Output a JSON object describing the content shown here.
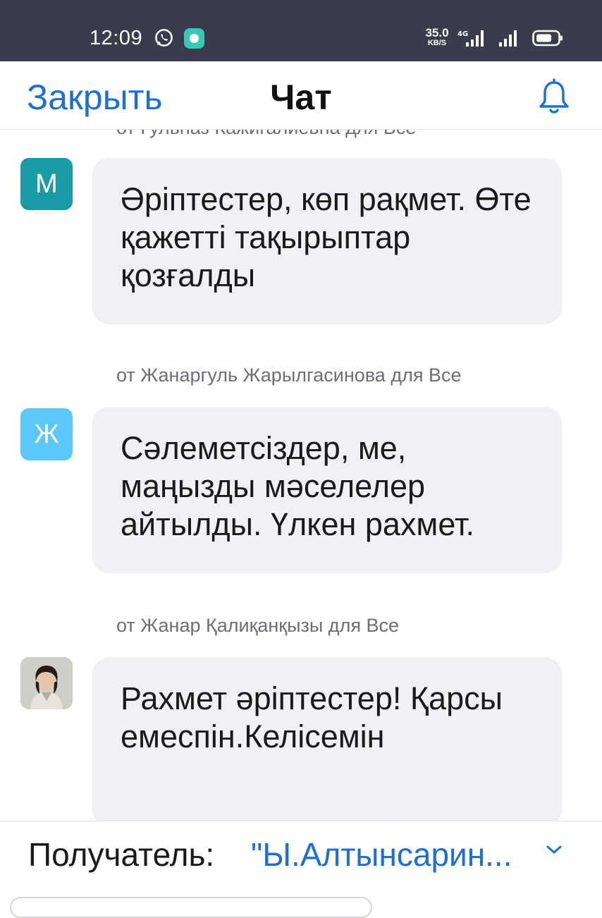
{
  "status_bar": {
    "time": "12:09",
    "net_speed_value": "35.0",
    "net_speed_unit": "KB/S",
    "network_type": "4G"
  },
  "nav": {
    "close_label": "Закрыть",
    "title": "Чат"
  },
  "messages": [
    {
      "sender": "от Гульназ Кажигалиевна для Все",
      "avatar_letter": "М",
      "avatar_color": "#1a9ba6",
      "text": "Әріптестер, көп рақмет. Өте қажетті тақырыптар қозғалды"
    },
    {
      "sender": "от Жанаргуль Жарылгасинова для Все",
      "avatar_letter": "Ж",
      "avatar_color": "#5ac8fa",
      "text": "Сәлеметсіздер, ме, маңызды мәселелер айтылды. Үлкен рахмет."
    },
    {
      "sender": "от Жанар Қалиқанқызы для Все",
      "avatar_letter": "",
      "avatar_color": "#c9ccc6",
      "text": "Рахмет әріптестер! Қарсы емеспін.Келісемін"
    }
  ],
  "recipient": {
    "label": "Получатель:",
    "value": "\"Ы.Алтынсарин..."
  },
  "colors": {
    "status_bar_bg": "#3a3c4d",
    "accent_blue": "#1d6fd6",
    "bubble_bg": "#f1f1f5"
  }
}
